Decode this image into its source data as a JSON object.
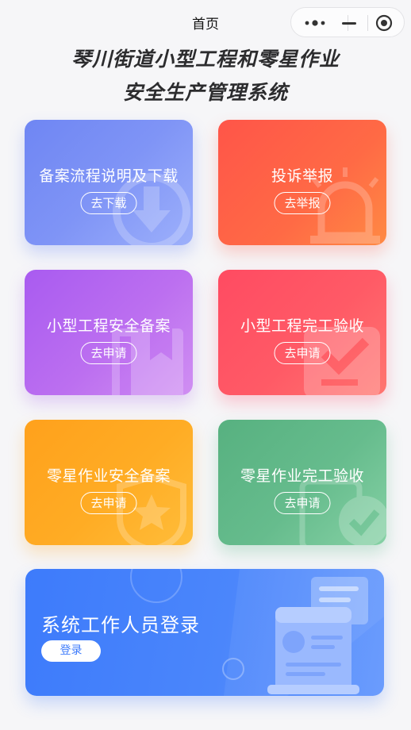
{
  "nav": {
    "title": "首页",
    "capsule": {
      "more_icon": "more-dots-icon",
      "minimize_icon": "minimize-icon",
      "close_icon": "target-circle-icon"
    }
  },
  "header": {
    "title_line1": "琴川街道小型工程和零星作业",
    "title_line2": "安全生产管理系统"
  },
  "cards": [
    {
      "title": "备案流程说明及下载",
      "button": "去下载",
      "icon": "download-icon",
      "color": "#7b8ff5"
    },
    {
      "title": "投诉举报",
      "button": "去举报",
      "icon": "alarm-siren-icon",
      "color": "#ff5e4a"
    },
    {
      "title": "小型工程安全备案",
      "button": "去申请",
      "icon": "bookmark-book-icon",
      "color": "#b55ef0"
    },
    {
      "title": "小型工程完工验收",
      "button": "去申请",
      "icon": "check-clipboard-icon",
      "color": "#ff4d64"
    },
    {
      "title": "零星作业安全备案",
      "button": "去申请",
      "icon": "star-badge-icon",
      "color": "#ffa91f"
    },
    {
      "title": "零星作业完工验收",
      "button": "去申请",
      "icon": "check-circle-icon",
      "color": "#5dba8a"
    }
  ],
  "banner": {
    "title": "系统工作人员登录",
    "button": "登录",
    "icon": "document-scroll-icon",
    "color": "#3d7bfb"
  }
}
